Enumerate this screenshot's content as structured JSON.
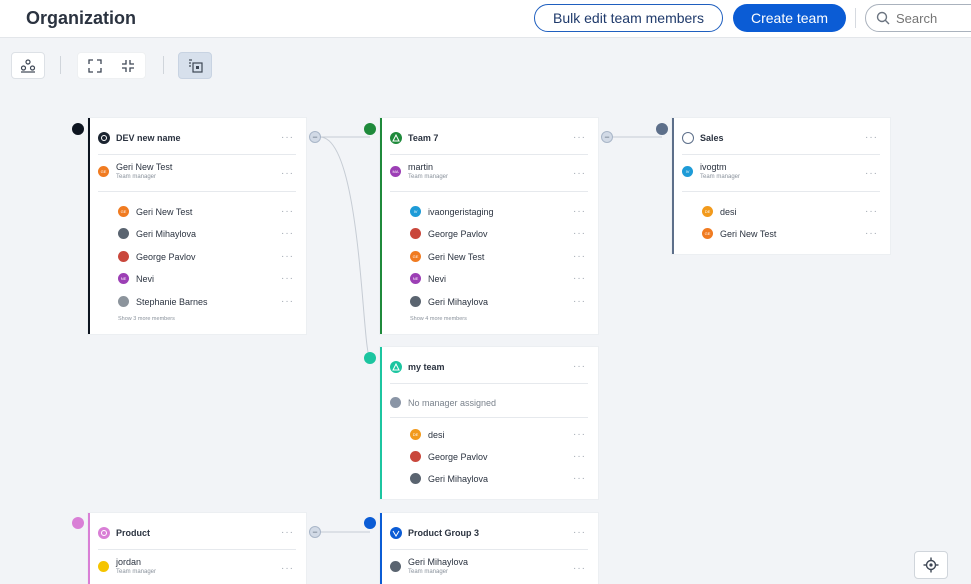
{
  "header": {
    "title": "Organization",
    "bulk_edit_label": "Bulk edit team members",
    "create_team_label": "Create team",
    "search_placeholder": "Search"
  },
  "colors": {
    "primary": "#0b5cd5",
    "dev": "#0d1420",
    "team7": "#1f8a3b",
    "sales": "#5d6f8a",
    "myteam": "#1cc5a0",
    "product": "#d97fd6",
    "productgroup": "#0b5cd5"
  },
  "teams": {
    "dev": {
      "name": "DEV new name",
      "manager": {
        "name": "Geri New Test",
        "role": "Team manager",
        "initials": "GE"
      },
      "members": [
        {
          "name": "Geri New Test",
          "initials": "GE"
        },
        {
          "name": "Geri Mihaylova",
          "initials": ""
        },
        {
          "name": "George Pavlov",
          "initials": ""
        },
        {
          "name": "Nevi",
          "initials": "NE"
        },
        {
          "name": "Stephanie Barnes",
          "initials": ""
        }
      ],
      "more": "Show 3 more members"
    },
    "team7": {
      "name": "Team 7",
      "manager": {
        "name": "martin",
        "role": "Team manager",
        "initials": "MA"
      },
      "members": [
        {
          "name": "ivaongeristaging",
          "initials": "IV"
        },
        {
          "name": "George Pavlov",
          "initials": ""
        },
        {
          "name": "Geri New Test",
          "initials": "GE"
        },
        {
          "name": "Nevi",
          "initials": "NE"
        },
        {
          "name": "Geri Mihaylova",
          "initials": ""
        }
      ],
      "more": "Show 4 more members"
    },
    "sales": {
      "name": "Sales",
      "manager": {
        "name": "ivogtm",
        "role": "Team manager",
        "initials": "IV"
      },
      "members": [
        {
          "name": "desi",
          "initials": "DE"
        },
        {
          "name": "Geri New Test",
          "initials": "GE"
        }
      ]
    },
    "myteam": {
      "name": "my team",
      "no_manager": "No manager assigned",
      "members": [
        {
          "name": "desi",
          "initials": "DE"
        },
        {
          "name": "George Pavlov",
          "initials": ""
        },
        {
          "name": "Geri Mihaylova",
          "initials": ""
        }
      ]
    },
    "product": {
      "name": "Product",
      "manager": {
        "name": "jordan",
        "role": "Team manager"
      }
    },
    "productgroup": {
      "name": "Product Group 3",
      "manager": {
        "name": "Geri Mihaylova",
        "role": "Team manager"
      }
    }
  },
  "more_icon": "···",
  "collapse_icon": "−"
}
